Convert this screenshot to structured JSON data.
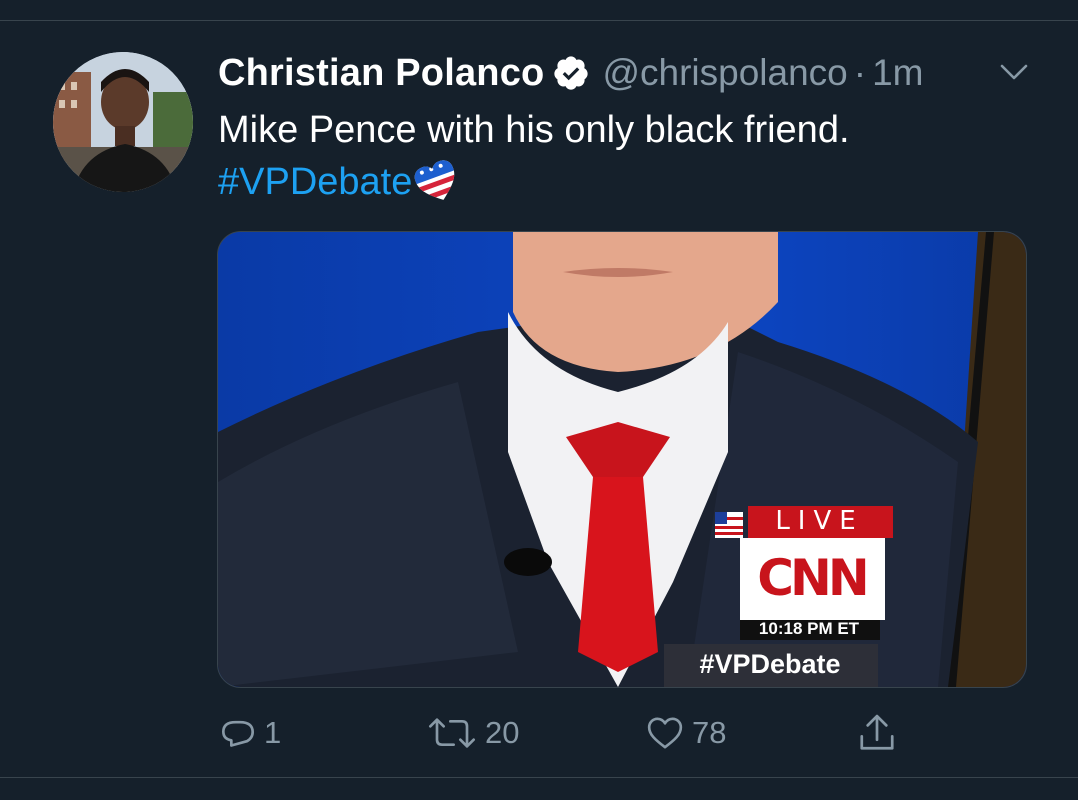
{
  "tweet": {
    "author": {
      "display_name": "Christian Polanco",
      "handle": "@chrispolanco",
      "verified": true,
      "avatar_icon": "profile-photo"
    },
    "time_separator": "·",
    "time": "1m",
    "text": "Mike Pence with his only black friend.",
    "hashtag": "#VPDebate",
    "hashflag_icon": "vp-debate-heart-flag-icon",
    "media": {
      "overlay_live": "LIVE",
      "overlay_network": "CNN",
      "overlay_clock": "10:18 PM ET",
      "overlay_hashtag": "#VPDebate"
    },
    "actions": {
      "replies": "1",
      "retweets": "20",
      "likes": "78",
      "share_icon": "share-icon"
    }
  },
  "colors": {
    "background": "#15202b",
    "secondary_text": "#8899a6",
    "link": "#1da1f2",
    "divider": "#38444d"
  }
}
